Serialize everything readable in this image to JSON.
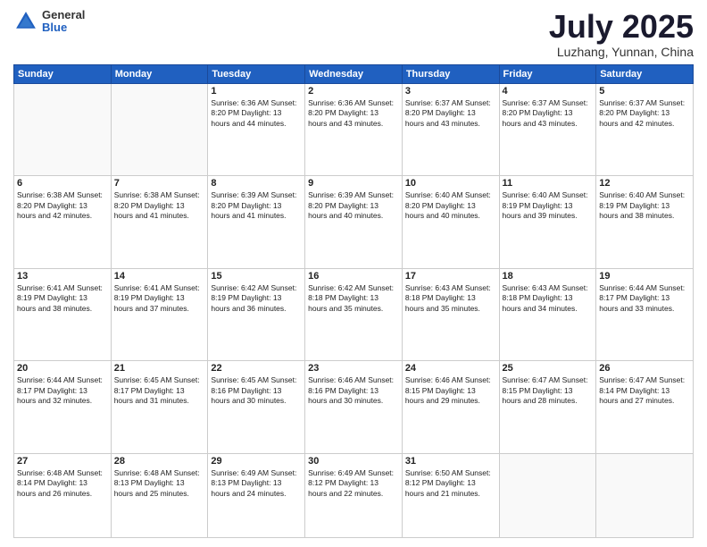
{
  "header": {
    "logo_general": "General",
    "logo_blue": "Blue",
    "month_title": "July 2025",
    "location": "Luzhang, Yunnan, China"
  },
  "weekdays": [
    "Sunday",
    "Monday",
    "Tuesday",
    "Wednesday",
    "Thursday",
    "Friday",
    "Saturday"
  ],
  "weeks": [
    [
      {
        "day": "",
        "info": ""
      },
      {
        "day": "",
        "info": ""
      },
      {
        "day": "1",
        "info": "Sunrise: 6:36 AM\nSunset: 8:20 PM\nDaylight: 13 hours and 44 minutes."
      },
      {
        "day": "2",
        "info": "Sunrise: 6:36 AM\nSunset: 8:20 PM\nDaylight: 13 hours and 43 minutes."
      },
      {
        "day": "3",
        "info": "Sunrise: 6:37 AM\nSunset: 8:20 PM\nDaylight: 13 hours and 43 minutes."
      },
      {
        "day": "4",
        "info": "Sunrise: 6:37 AM\nSunset: 8:20 PM\nDaylight: 13 hours and 43 minutes."
      },
      {
        "day": "5",
        "info": "Sunrise: 6:37 AM\nSunset: 8:20 PM\nDaylight: 13 hours and 42 minutes."
      }
    ],
    [
      {
        "day": "6",
        "info": "Sunrise: 6:38 AM\nSunset: 8:20 PM\nDaylight: 13 hours and 42 minutes."
      },
      {
        "day": "7",
        "info": "Sunrise: 6:38 AM\nSunset: 8:20 PM\nDaylight: 13 hours and 41 minutes."
      },
      {
        "day": "8",
        "info": "Sunrise: 6:39 AM\nSunset: 8:20 PM\nDaylight: 13 hours and 41 minutes."
      },
      {
        "day": "9",
        "info": "Sunrise: 6:39 AM\nSunset: 8:20 PM\nDaylight: 13 hours and 40 minutes."
      },
      {
        "day": "10",
        "info": "Sunrise: 6:40 AM\nSunset: 8:20 PM\nDaylight: 13 hours and 40 minutes."
      },
      {
        "day": "11",
        "info": "Sunrise: 6:40 AM\nSunset: 8:19 PM\nDaylight: 13 hours and 39 minutes."
      },
      {
        "day": "12",
        "info": "Sunrise: 6:40 AM\nSunset: 8:19 PM\nDaylight: 13 hours and 38 minutes."
      }
    ],
    [
      {
        "day": "13",
        "info": "Sunrise: 6:41 AM\nSunset: 8:19 PM\nDaylight: 13 hours and 38 minutes."
      },
      {
        "day": "14",
        "info": "Sunrise: 6:41 AM\nSunset: 8:19 PM\nDaylight: 13 hours and 37 minutes."
      },
      {
        "day": "15",
        "info": "Sunrise: 6:42 AM\nSunset: 8:19 PM\nDaylight: 13 hours and 36 minutes."
      },
      {
        "day": "16",
        "info": "Sunrise: 6:42 AM\nSunset: 8:18 PM\nDaylight: 13 hours and 35 minutes."
      },
      {
        "day": "17",
        "info": "Sunrise: 6:43 AM\nSunset: 8:18 PM\nDaylight: 13 hours and 35 minutes."
      },
      {
        "day": "18",
        "info": "Sunrise: 6:43 AM\nSunset: 8:18 PM\nDaylight: 13 hours and 34 minutes."
      },
      {
        "day": "19",
        "info": "Sunrise: 6:44 AM\nSunset: 8:17 PM\nDaylight: 13 hours and 33 minutes."
      }
    ],
    [
      {
        "day": "20",
        "info": "Sunrise: 6:44 AM\nSunset: 8:17 PM\nDaylight: 13 hours and 32 minutes."
      },
      {
        "day": "21",
        "info": "Sunrise: 6:45 AM\nSunset: 8:17 PM\nDaylight: 13 hours and 31 minutes."
      },
      {
        "day": "22",
        "info": "Sunrise: 6:45 AM\nSunset: 8:16 PM\nDaylight: 13 hours and 30 minutes."
      },
      {
        "day": "23",
        "info": "Sunrise: 6:46 AM\nSunset: 8:16 PM\nDaylight: 13 hours and 30 minutes."
      },
      {
        "day": "24",
        "info": "Sunrise: 6:46 AM\nSunset: 8:15 PM\nDaylight: 13 hours and 29 minutes."
      },
      {
        "day": "25",
        "info": "Sunrise: 6:47 AM\nSunset: 8:15 PM\nDaylight: 13 hours and 28 minutes."
      },
      {
        "day": "26",
        "info": "Sunrise: 6:47 AM\nSunset: 8:14 PM\nDaylight: 13 hours and 27 minutes."
      }
    ],
    [
      {
        "day": "27",
        "info": "Sunrise: 6:48 AM\nSunset: 8:14 PM\nDaylight: 13 hours and 26 minutes."
      },
      {
        "day": "28",
        "info": "Sunrise: 6:48 AM\nSunset: 8:13 PM\nDaylight: 13 hours and 25 minutes."
      },
      {
        "day": "29",
        "info": "Sunrise: 6:49 AM\nSunset: 8:13 PM\nDaylight: 13 hours and 24 minutes."
      },
      {
        "day": "30",
        "info": "Sunrise: 6:49 AM\nSunset: 8:12 PM\nDaylight: 13 hours and 22 minutes."
      },
      {
        "day": "31",
        "info": "Sunrise: 6:50 AM\nSunset: 8:12 PM\nDaylight: 13 hours and 21 minutes."
      },
      {
        "day": "",
        "info": ""
      },
      {
        "day": "",
        "info": ""
      }
    ]
  ]
}
